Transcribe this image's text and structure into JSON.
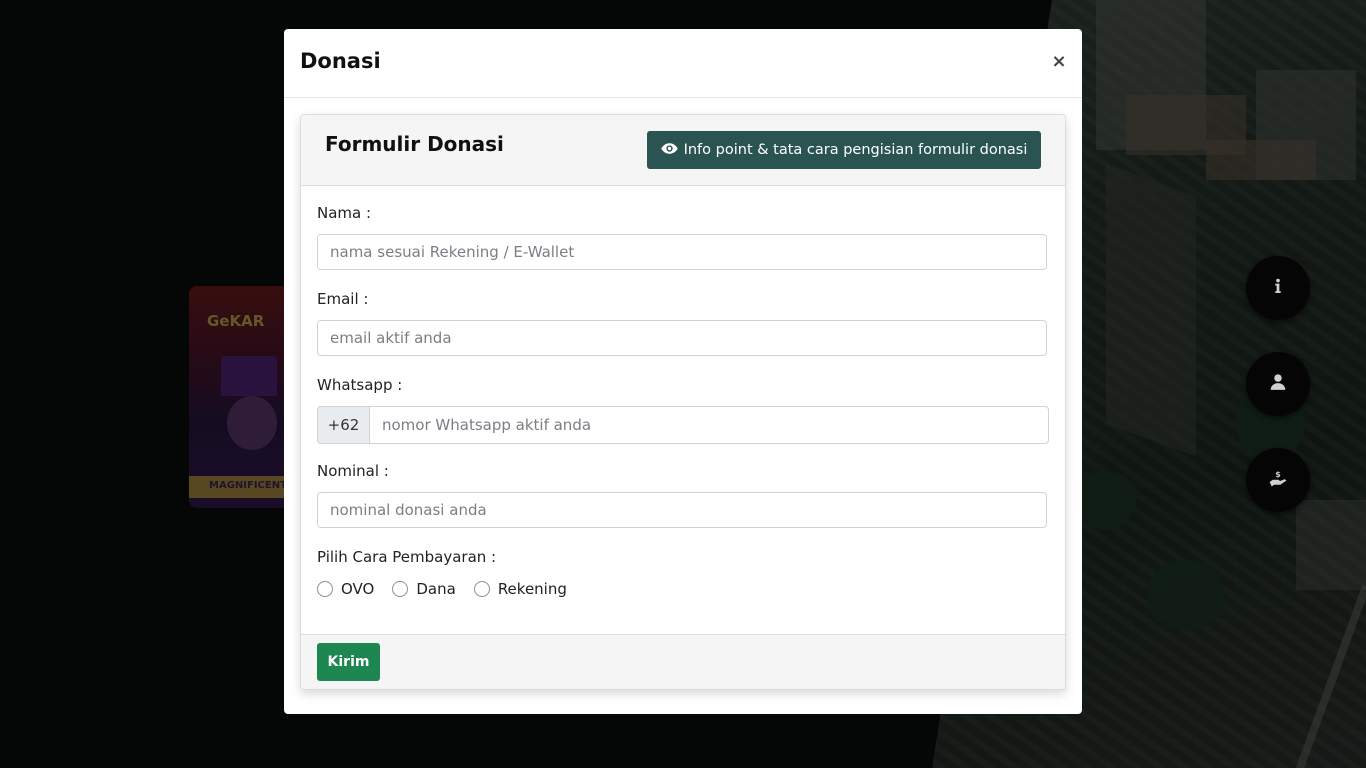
{
  "modal": {
    "title": "Donasi",
    "close_label": "×"
  },
  "form": {
    "title": "Formulir Donasi",
    "info_button_label": "Info point & tata cara pengisian formulir donasi",
    "fields": {
      "nama": {
        "label": "Nama :",
        "placeholder": "nama sesuai Rekening / E-Wallet",
        "value": ""
      },
      "email": {
        "label": "Email :",
        "placeholder": "email aktif anda",
        "value": ""
      },
      "whatsapp": {
        "label": "Whatsapp :",
        "prefix": "+62",
        "placeholder": "nomor Whatsapp aktif anda",
        "value": ""
      },
      "nominal": {
        "label": "Nominal :",
        "placeholder": "nominal donasi anda",
        "value": ""
      }
    },
    "payment": {
      "label": "Pilih Cara Pembayaran :",
      "options": [
        "OVO",
        "Dana",
        "Rekening"
      ],
      "selected": null
    },
    "submit_label": "Kirim"
  },
  "background": {
    "poster_title": "GeKAR",
    "poster_ribbon": "MAGNIFICENT"
  },
  "floating_buttons": [
    {
      "icon": "info-icon"
    },
    {
      "icon": "user-icon"
    },
    {
      "icon": "donate-hand-icon"
    }
  ],
  "colors": {
    "info_button": "#2a5452",
    "submit_button": "#1e8651",
    "fab_background": "#050505"
  }
}
